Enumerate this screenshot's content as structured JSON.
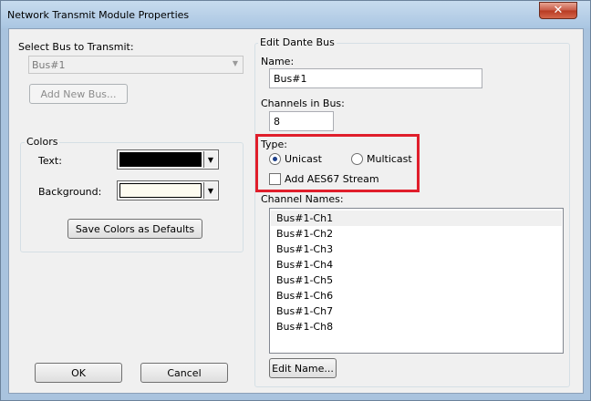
{
  "window": {
    "title": "Network Transmit Module Properties",
    "close_glyph": "✕"
  },
  "left": {
    "select_bus_label": "Select Bus to Transmit:",
    "bus_value": "Bus#1",
    "add_new_bus_label": "Add New Bus...",
    "colors_group_label": "Colors",
    "text_label": "Text:",
    "background_label": "Background:",
    "save_colors_label": "Save Colors as Defaults",
    "text_color": "#000000",
    "background_color": "#fdfbf0"
  },
  "right": {
    "group_label": "Edit Dante Bus",
    "name_label": "Name:",
    "name_value": "Bus#1",
    "channels_label": "Channels in Bus:",
    "channels_value": "8",
    "type_label": "Type:",
    "unicast_label": "Unicast",
    "multicast_label": "Multicast",
    "aes67_label": "Add AES67 Stream",
    "channel_names_label": "Channel Names:",
    "channels": [
      "Bus#1-Ch1",
      "Bus#1-Ch2",
      "Bus#1-Ch3",
      "Bus#1-Ch4",
      "Bus#1-Ch5",
      "Bus#1-Ch6",
      "Bus#1-Ch7",
      "Bus#1-Ch8"
    ],
    "edit_name_label": "Edit Name..."
  },
  "footer": {
    "ok_label": "OK",
    "cancel_label": "Cancel"
  },
  "accent": {
    "highlight_color": "#e01e2b"
  }
}
